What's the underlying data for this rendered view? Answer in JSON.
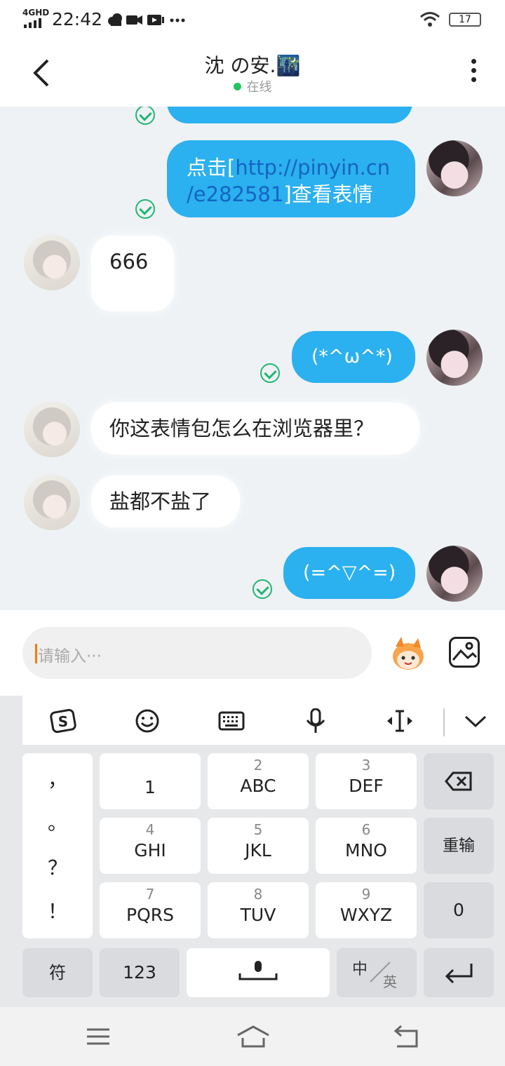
{
  "status_bar": {
    "network": "4GHD",
    "time": "22:42",
    "battery": "17",
    "icons": [
      "cloud-icon",
      "video-icon",
      "video-play-icon",
      "more-dots-icon",
      "wifi-icon",
      "battery-icon"
    ]
  },
  "header": {
    "contact_name": "沈 の安.🌃",
    "status": "在线",
    "status_color": "#22c55e"
  },
  "messages": [
    {
      "from": "me",
      "text": "点击[http://pinyin.cn/e282581]查看表情",
      "partial": true
    },
    {
      "from": "me",
      "prefix": "点击[",
      "link_line1": "http://pinyin.cn",
      "link_line2": "/e282581",
      "suffix": "]查看表情",
      "status": "read"
    },
    {
      "from": "them",
      "text": "666"
    },
    {
      "from": "me",
      "text": "(*^ω^*)",
      "status": "read"
    },
    {
      "from": "them",
      "text": "你这表情包怎么在浏览器里？"
    },
    {
      "from": "them",
      "text": "盐都不盐了"
    },
    {
      "from": "me",
      "text": "(=^▽^=)",
      "status": "read"
    }
  ],
  "input": {
    "placeholder": "请输入···"
  },
  "keyboard": {
    "toolbar": [
      "sogou-logo-icon",
      "emoji-icon",
      "keyboard-icon",
      "microphone-icon",
      "cursor-move-icon",
      "collapse-icon"
    ],
    "punctuation": [
      "，",
      "。",
      "？",
      "！"
    ],
    "keys": [
      {
        "num": "",
        "letters": "1"
      },
      {
        "num": "2",
        "letters": "ABC"
      },
      {
        "num": "3",
        "letters": "DEF"
      },
      {
        "num": "4",
        "letters": "GHI"
      },
      {
        "num": "5",
        "letters": "JKL"
      },
      {
        "num": "6",
        "letters": "MNO"
      },
      {
        "num": "7",
        "letters": "PQRS"
      },
      {
        "num": "8",
        "letters": "TUV"
      },
      {
        "num": "9",
        "letters": "WXYZ"
      }
    ],
    "reenter": "重输",
    "zero": "0",
    "symbols": "符",
    "numbers": "123",
    "lang_cn": "中",
    "lang_en": "英"
  },
  "accent_colors": {
    "outgoing_bubble": "#2bb0f0",
    "read_check": "#22b573",
    "link": "#1565c0",
    "caret": "#f57c00"
  }
}
